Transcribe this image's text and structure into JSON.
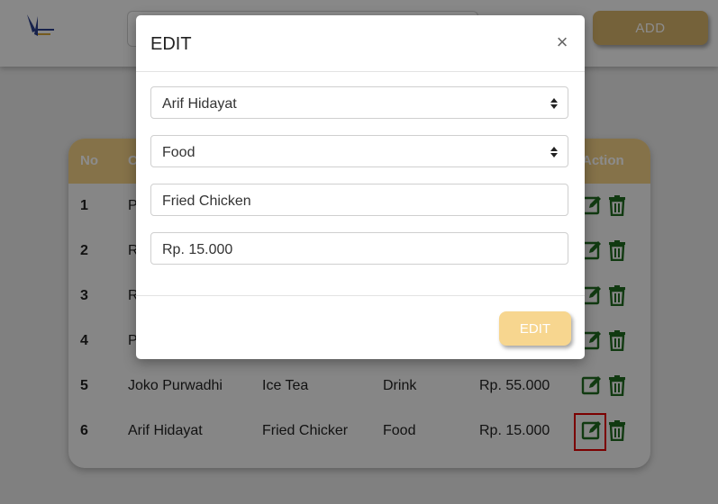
{
  "header": {
    "add_label": "ADD",
    "search": {
      "value": ""
    }
  },
  "table": {
    "columns": [
      "No",
      "C",
      "",
      "",
      "",
      "Action"
    ],
    "rows": [
      {
        "no": "1",
        "c1": "P",
        "c2": "",
        "c3": "",
        "c4": ""
      },
      {
        "no": "2",
        "c1": "R",
        "c2": "",
        "c3": "",
        "c4": ""
      },
      {
        "no": "3",
        "c1": "R",
        "c2": "",
        "c3": "",
        "c4": ""
      },
      {
        "no": "4",
        "c1": "P",
        "c2": "",
        "c3": "",
        "c4": ""
      },
      {
        "no": "5",
        "c1": "Joko Purwadhi",
        "c2": "Ice Tea",
        "c3": "Drink",
        "c4": "Rp. 55.000"
      },
      {
        "no": "6",
        "c1": "Arif Hidayat",
        "c2": "Fried Chicker",
        "c3": "Food",
        "c4": "Rp. 15.000"
      }
    ]
  },
  "modal": {
    "title": "EDIT",
    "close": "×",
    "customer_select": "Arif Hidayat",
    "category_select": "Food",
    "item_name_value": "Fried Chicken",
    "price_value": "Rp. 15.000",
    "submit_label": "EDIT"
  },
  "colors": {
    "accent": "#d6b26a",
    "table_header": "#f2cf86",
    "icon_green": "#1f6b1f",
    "highlight": "#e00000"
  },
  "icons": {
    "edit": "edit-icon",
    "delete": "trash-icon",
    "select": "sort-arrows-icon"
  }
}
